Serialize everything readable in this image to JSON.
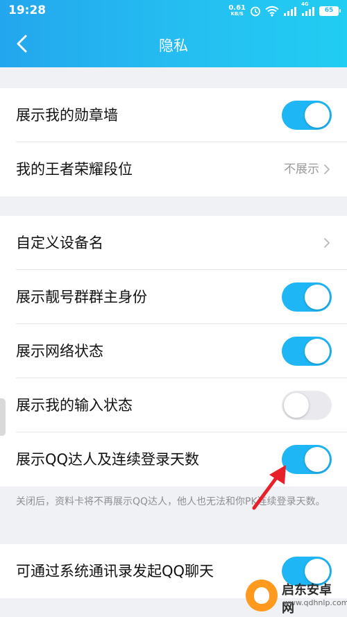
{
  "status_bar": {
    "time": "19:28",
    "net_speed_value": "0.61",
    "net_speed_unit": "KB/S",
    "network_tag": "4G",
    "battery": "65"
  },
  "header": {
    "title": "隐私"
  },
  "group1": [
    {
      "label": "展示我的勋章墙",
      "type": "toggle",
      "on": true
    },
    {
      "label": "我的王者荣耀段位",
      "type": "link",
      "value": "不展示"
    }
  ],
  "group2": [
    {
      "label": "自定义设备名",
      "type": "link"
    },
    {
      "label": "展示靓号群群主身份",
      "type": "toggle",
      "on": true
    },
    {
      "label": "展示网络状态",
      "type": "toggle",
      "on": true
    },
    {
      "label": "展示我的输入状态",
      "type": "toggle",
      "on": false
    },
    {
      "label": "展示QQ达人及连续登录天数",
      "type": "toggle",
      "on": true
    }
  ],
  "footnote": "关闭后，资料卡将不再展示QQ达人，他人也无法和你PK连续登录天数。",
  "group3": [
    {
      "label": "可通过系统通讯录发起QQ聊天",
      "type": "toggle",
      "on": true
    }
  ],
  "watermark": {
    "name": "启东安卓网",
    "url": "www.qdhnlp.com"
  },
  "colors": {
    "header_gradient_start": "#23a6ee",
    "header_gradient_end": "#21cdf2",
    "toggle_on": "#1fb6f5",
    "toggle_off": "#e9e9ee",
    "annotation_arrow": "#e8202a",
    "page_background": "#f0f1f5"
  },
  "icons": {
    "back": "chevron-left-icon",
    "row_arrow": "chevron-right-icon",
    "alarm": "alarm-icon",
    "wifi": "wifi-icon",
    "signal": "signal-bars-icon",
    "battery": "battery-icon"
  }
}
